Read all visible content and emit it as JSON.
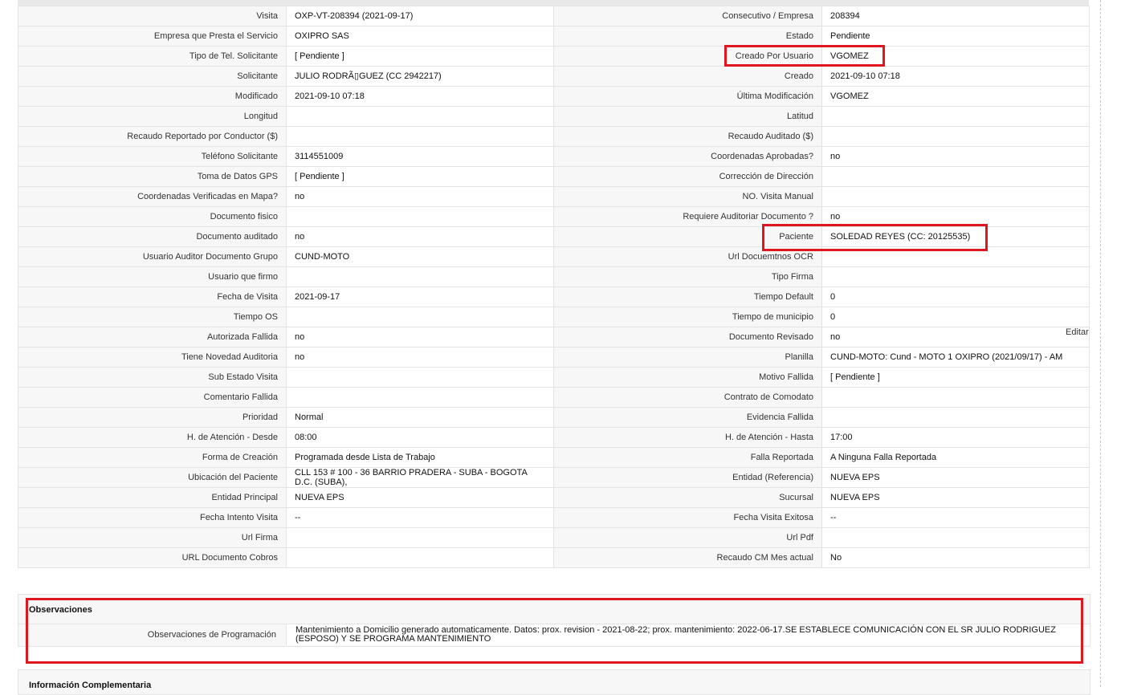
{
  "edit_link": "Editar",
  "rows": [
    {
      "l1": "Visita",
      "v1": "OXP-VT-208394 (2021-09-17)",
      "l2": "Consecutivo / Empresa",
      "v2": "208394"
    },
    {
      "l1": "Empresa que Presta el Servicio",
      "v1": "OXIPRO SAS",
      "l2": "Estado",
      "v2": "Pendiente"
    },
    {
      "l1": "Tipo de Tel. Solicitante",
      "v1": "[ Pendiente ]",
      "l2": "Creado Por Usuario",
      "v2": "VGOMEZ"
    },
    {
      "l1": "Solicitante",
      "v1": "JULIO RODRÃ▯GUEZ (CC 2942217)",
      "l2": "Creado",
      "v2": "2021-09-10 07:18"
    },
    {
      "l1": "Modificado",
      "v1": "2021-09-10 07:18",
      "l2": "Última Modificación",
      "v2": " VGOMEZ"
    },
    {
      "l1": "Longitud",
      "v1": "",
      "l2": "Latitud",
      "v2": ""
    },
    {
      "l1": "Recaudo Reportado por Conductor ($)",
      "v1": "",
      "l2": "Recaudo Auditado ($)",
      "v2": ""
    },
    {
      "l1": "Teléfono Solicitante",
      "v1": "3114551009",
      "l2": "Coordenadas Aprobadas?",
      "v2": " no"
    },
    {
      "l1": "Toma de Datos GPS",
      "v1": "[ Pendiente ]",
      "l2": "Corrección de Dirección",
      "v2": ""
    },
    {
      "l1": "Coordenadas Verificadas en Mapa?",
      "v1": " no",
      "l2": "NO. Visita Manual",
      "v2": ""
    },
    {
      "l1": "Documento fisico",
      "v1": "",
      "l2": "Requiere Auditoriar Documento ?",
      "v2": " no"
    },
    {
      "l1": "Documento auditado",
      "v1": " no",
      "l2": "Paciente",
      "v2": "SOLEDAD REYES (CC: 20125535)"
    },
    {
      "l1": "Usuario Auditor Documento Grupo",
      "v1": "CUND-MOTO",
      "l2": "Url Docuemtnos OCR",
      "v2": ""
    },
    {
      "l1": "Usuario que firmo",
      "v1": "",
      "l2": "Tipo Firma",
      "v2": ""
    },
    {
      "l1": "Fecha de Visita",
      "v1": " 2021-09-17",
      "l2": "Tiempo Default",
      "v2": "0"
    },
    {
      "l1": "Tiempo OS",
      "v1": "",
      "l2": "Tiempo de municipio",
      "v2": "0"
    },
    {
      "l1": "Autorizada Fallida",
      "v1": " no",
      "l2": "Documento Revisado",
      "v2": " no"
    },
    {
      "l1": "Tiene Novedad Auditoria",
      "v1": " no",
      "l2": "Planilla",
      "v2": "CUND-MOTO: Cund - MOTO 1 OXIPRO (2021/09/17) - AM"
    },
    {
      "l1": "Sub Estado Visita",
      "v1": "",
      "l2": "Motivo Fallida",
      "v2": "[ Pendiente ]"
    },
    {
      "l1": "Comentario Fallida",
      "v1": "",
      "l2": "Contrato de Comodato",
      "v2": ""
    },
    {
      "l1": "Prioridad",
      "v1": "Normal",
      "l2": "Evidencia Fallida",
      "v2": ""
    },
    {
      "l1": "H. de Atención - Desde",
      "v1": "08:00",
      "l2": "H. de Atención - Hasta",
      "v2": "17:00"
    },
    {
      "l1": "Forma de Creación",
      "v1": "Programada desde Lista de Trabajo",
      "l2": "Falla Reportada",
      "v2": "A Ninguna Falla Reportada"
    },
    {
      "l1": "Ubicación del Paciente",
      "v1": "CLL 153 # 100 - 36 BARRIO PRADERA - SUBA - BOGOTA D.C. (SUBA),",
      "l2": "Entidad (Referencia)",
      "v2": "NUEVA EPS"
    },
    {
      "l1": "Entidad Principal",
      "v1": "NUEVA EPS",
      "l2": "Sucursal",
      "v2": "NUEVA EPS"
    },
    {
      "l1": "Fecha Intento Visita",
      "v1": " --",
      "l2": "Fecha Visita Exitosa",
      "v2": " --"
    },
    {
      "l1": "Url Firma",
      "v1": "",
      "l2": "Url Pdf",
      "v2": ""
    },
    {
      "l1": "URL Documento Cobros",
      "v1": "",
      "l2": "Recaudo CM Mes actual",
      "v2": "No"
    }
  ],
  "observaciones": {
    "title": "Observaciones",
    "label": "Observaciones de Programación",
    "value": "  Mantenimiento a Domicilio generado automaticamente. Datos: prox. revision - 2021-08-22; prox. mantenimiento: 2022-06-17.SE ESTABLECE COMUNICACIÓN CON EL SR JULIO RODRIGUEZ (ESPOSO) Y SE PROGRAMA MANTENIMIENTO"
  },
  "info_complementaria": {
    "title": "Información Complementaria"
  },
  "highlight_color": "#e0161f"
}
